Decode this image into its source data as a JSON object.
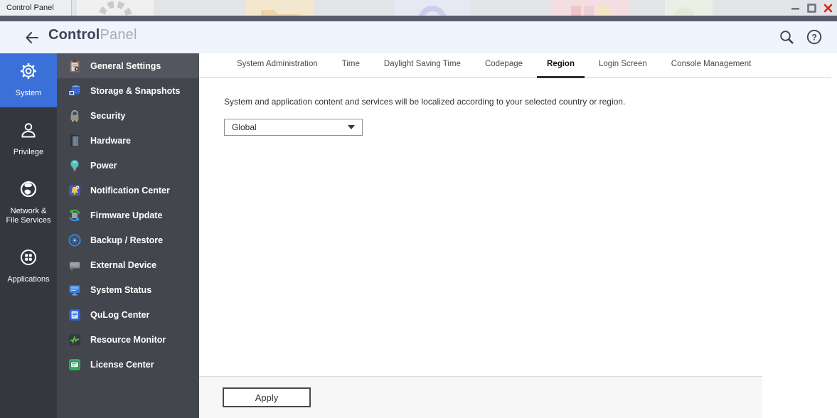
{
  "titlebar": {
    "tab_label": "Control Panel",
    "window_controls": [
      "minimize",
      "maximize",
      "close"
    ]
  },
  "header": {
    "title_bold": "Control",
    "title_light": "Panel"
  },
  "sidebar_rail": {
    "items": [
      {
        "id": "system",
        "lines": [
          "System"
        ],
        "icon": "gear-icon",
        "active": true
      },
      {
        "id": "privilege",
        "lines": [
          "Privilege"
        ],
        "icon": "user-icon",
        "active": false
      },
      {
        "id": "network-file-services",
        "lines": [
          "Network &",
          "File Services"
        ],
        "icon": "globe-icon",
        "active": false
      },
      {
        "id": "applications",
        "lines": [
          "Applications"
        ],
        "icon": "apps-grid-icon",
        "active": false
      }
    ]
  },
  "sidebar_menu": {
    "items": [
      {
        "label": "General Settings",
        "icon": "clipboard-settings-icon",
        "active": true
      },
      {
        "label": "Storage & Snapshots",
        "icon": "storage-disks-icon",
        "active": false
      },
      {
        "label": "Security",
        "icon": "padlock-icon",
        "active": false
      },
      {
        "label": "Hardware",
        "icon": "nas-tower-icon",
        "active": false
      },
      {
        "label": "Power",
        "icon": "power-bulb-icon",
        "active": false
      },
      {
        "label": "Notification Center",
        "icon": "notification-bell-icon",
        "active": false
      },
      {
        "label": "Firmware Update",
        "icon": "firmware-update-icon",
        "active": false
      },
      {
        "label": "Backup / Restore",
        "icon": "backup-gear-icon",
        "active": false
      },
      {
        "label": "External Device",
        "icon": "external-drive-icon",
        "active": false
      },
      {
        "label": "System Status",
        "icon": "status-monitor-icon",
        "active": false
      },
      {
        "label": "QuLog Center",
        "icon": "qulog-doc-icon",
        "active": false
      },
      {
        "label": "Resource Monitor",
        "icon": "resource-waveform-icon",
        "active": false
      },
      {
        "label": "License Center",
        "icon": "license-card-icon",
        "active": false
      }
    ]
  },
  "tabs": {
    "items": [
      {
        "label": "System Administration",
        "active": false
      },
      {
        "label": "Time",
        "active": false
      },
      {
        "label": "Daylight Saving Time",
        "active": false
      },
      {
        "label": "Codepage",
        "active": false
      },
      {
        "label": "Region",
        "active": true
      },
      {
        "label": "Login Screen",
        "active": false
      },
      {
        "label": "Console Management",
        "active": false
      }
    ]
  },
  "region_panel": {
    "description": "System and application content and services will be localized according to your selected country or region.",
    "region_select": {
      "value": "Global"
    },
    "apply_label": "Apply"
  },
  "colors": {
    "accent_blue": "#3b70d9",
    "rail_bg": "#34373d",
    "menu_bg": "#43464c",
    "menu_selected_bg": "#53565e",
    "header_bg": "#f0f4fc",
    "titlebar_strip": "#575b6d",
    "close_red": "#d5281e",
    "footer_bg": "#f7f7f8",
    "tab_underline": "#2e2e2e"
  }
}
